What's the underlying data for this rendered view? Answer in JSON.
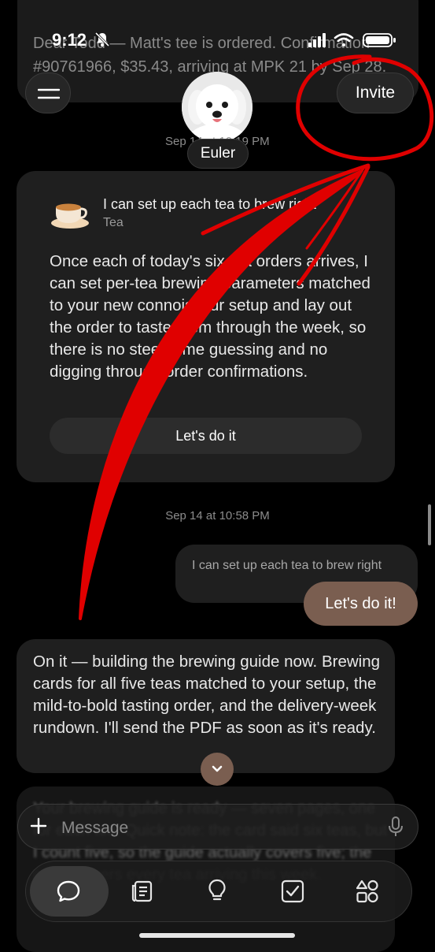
{
  "status": {
    "time": "9:12"
  },
  "background_message": {
    "text": "Dear Todd — Matt's tee is ordered. Confirmation #90761966, $35.43, arriving at MPK 21 by Sep 28."
  },
  "header": {
    "invite_label": "Invite",
    "agent_name": "Euler",
    "timestamp": "Sep 14 at 10:19 PM"
  },
  "card": {
    "title": "I can set up each tea to brew right",
    "subtitle": "Tea",
    "body": "Once each of today's six tea orders arrives, I can set per-tea brewing parameters matched to your new connoisseur setup and lay out the order to taste them through the week, so there is no steep-time guessing and no digging through order confirmations.",
    "button_label": "Let's do it"
  },
  "thread": {
    "timestamp": "Sep 14 at 10:58 PM",
    "quoted_text": "I can set up each tea to brew right",
    "user_message": "Let's do it!",
    "bot_message": "On it — building the brewing guide now. Brewing cards for all five teas matched to your setup, the mild-to-bold tasting order, and the delivery-week rundown. I'll send the PDF as soon as it's ready.",
    "next_message_blurred": "Your brewing guide is ready — seven pages, one for each tea. Quick note: the card said six teas, but I count five, so the guide actually covers five; the guide covers every tea arriving this week."
  },
  "composer": {
    "placeholder": "Message"
  },
  "tabs": [
    {
      "icon": "chat-icon",
      "active": true
    },
    {
      "icon": "notes-icon",
      "active": false
    },
    {
      "icon": "lightbulb-icon",
      "active": false
    },
    {
      "icon": "checkbox-icon",
      "active": false
    },
    {
      "icon": "apps-icon",
      "active": false
    }
  ],
  "colors": {
    "accent": "#7a5e50",
    "annotation": "#e00000",
    "background": "#000000"
  }
}
